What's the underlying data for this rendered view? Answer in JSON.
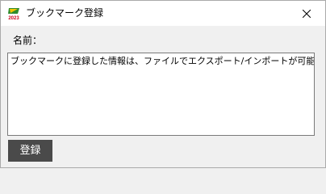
{
  "window": {
    "title": "ブックマーク登録",
    "icon": "app-logo-icon",
    "icon_text": "2023",
    "close_icon": "close-icon"
  },
  "form": {
    "name_label": "名前：",
    "name_value": "ブックマークに登録した情報は、ファイルでエクスポート/インポートが可能",
    "register_label": "登録"
  },
  "colors": {
    "titlebar_bg": "#ffffff",
    "window_bg": "#f0f0f0",
    "button_bg": "#4a4a4a",
    "button_text": "#ffffff",
    "field_border": "#7a7a7a"
  }
}
